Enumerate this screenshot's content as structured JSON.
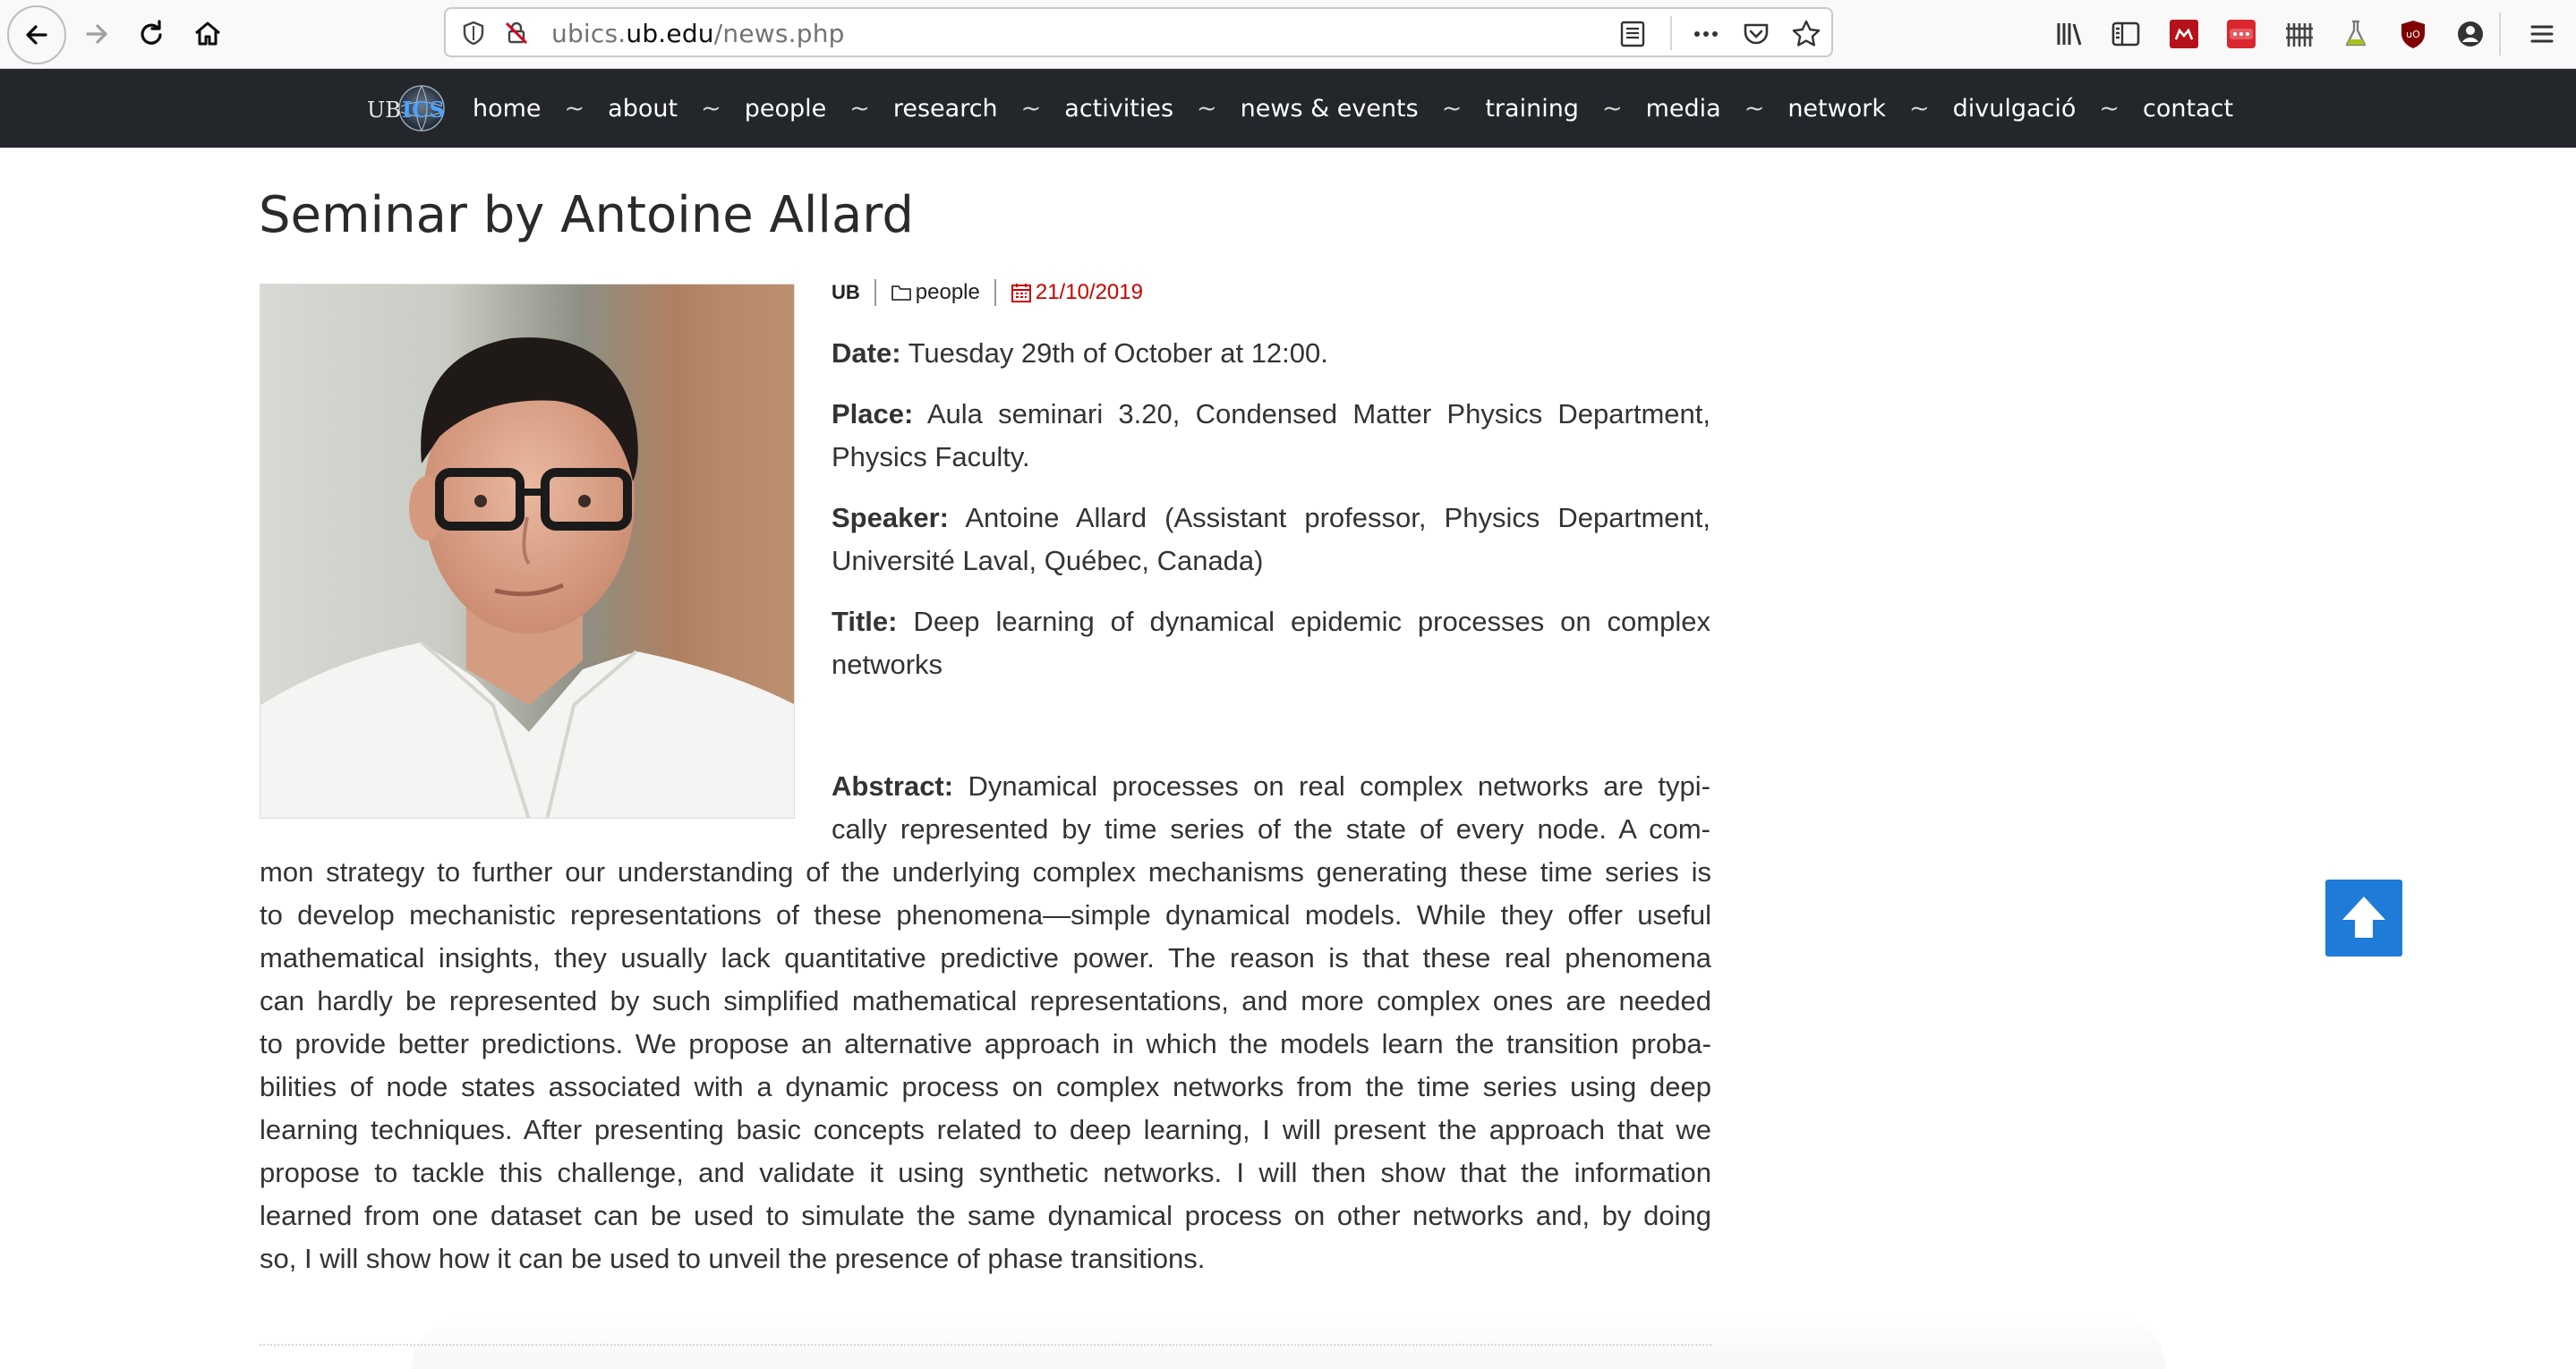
{
  "browser": {
    "url_prefix": "ubics.",
    "url_domain": "ub.edu",
    "url_path": "/news.php",
    "icons": [
      "back-arrow-icon",
      "forward-arrow-icon",
      "reload-icon",
      "home-icon",
      "shield-icon",
      "insecure-lock-icon",
      "reader-view-icon",
      "more-icon",
      "pocket-icon",
      "bookmark-star-icon",
      "library-icon",
      "sidebar-icon",
      "extension-icon",
      "extension-icon",
      "extension-icon",
      "extension-icon",
      "ublock-icon",
      "account-icon",
      "menu-icon"
    ]
  },
  "site": {
    "logo_text_left": "UB",
    "logo_text_right": "ICS",
    "nav": [
      "home",
      "about",
      "people",
      "research",
      "activities",
      "news & events",
      "training",
      "media",
      "network",
      "divulgació",
      "contact"
    ],
    "separator": "~"
  },
  "article": {
    "title": "Seminar by Antoine Allard",
    "source": "UB",
    "category": "people",
    "date": "21/10/2019",
    "date_label": "Date:",
    "date_value": " Tuesday 29th of October at 12:00.",
    "place_label": "Place:",
    "place_value": " Aula seminari 3.20, Condensed Matter Physics Department, Physics Faculty.",
    "speaker_label": "Speaker:",
    "speaker_value": " Antoine Allard (Assistant professor, Physics Department, Université Laval, Québec, Canada)",
    "title_label": "Title:",
    "title_value": " Deep learning of dynamical epidemic processes on complex networks",
    "abstract_label": "Abstract:",
    "abstract_lines": [
      " Dynamical processes on real complex networks are typi-",
      "cally represented by time series of the state of every node. A com-",
      "mon strategy to further our understanding of the underlying complex mechanisms generating these time series is",
      "to develop mechanistic representations of these phenomena—simple dynamical models. While they offer useful",
      "mathematical insights, they usually lack quantitative predictive power.  The reason is that these real phenomena",
      "can hardly be represented by such simplified mathematical representations, and more complex ones are needed",
      "to provide better predictions. We propose an alternative approach in which the models learn the transition proba-",
      "bilities of node states associated with a dynamic process on complex networks from the time series using deep",
      "learning techniques. After presenting basic concepts related to deep learning, I will present the approach that we",
      "propose to tackle this challenge, and validate it using synthetic networks. I will then show that the information",
      "learned from one dataset can be used to simulate the same dynamical process on other networks and, by doing",
      "so, I will show how it can be used to unveil the presence of phase transitions."
    ]
  },
  "colors": {
    "nav_bg": "#23262a",
    "date_red": "#cc0000",
    "to_top_blue": "#1f7bd8"
  }
}
